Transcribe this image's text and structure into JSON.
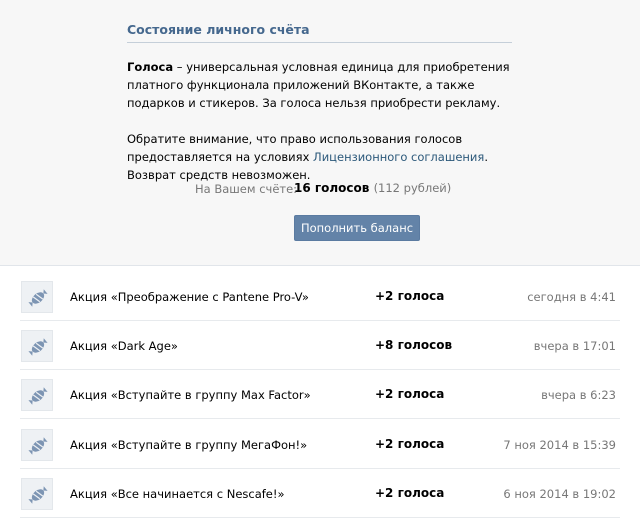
{
  "header": {
    "title": "Состояние личного счёта",
    "para1_bold": "Голоса",
    "para1_rest": " – универсальная условная единица для приобретения платного функционала приложений ВКонтакте, а также подарков и стикеров. За голоса нельзя приобрести рекламу.",
    "para2_before": "Обратите внимание, что право использования голосов предоставляется на условиях ",
    "para2_link": "Лицензионного соглашения",
    "para2_after": ". Возврат средств невозможен.",
    "balance_label": "На Вашем счёте:",
    "balance_value": "16 голосов",
    "balance_rub": "(112 рублей)",
    "topup_button": "Пополнить баланс"
  },
  "transactions": [
    {
      "name": "Акция «Преображение с Pantene Pro-V»",
      "amount": "+2 голоса",
      "time": "сегодня в 4:41",
      "icon": "candy-icon"
    },
    {
      "name": "Акция «Dark Age»",
      "amount": "+8 голосов",
      "time": "вчера в 17:01",
      "icon": "candy-icon"
    },
    {
      "name": "Акция «Вступайте в группу Max Factor»",
      "amount": "+2 голоса",
      "time": "вчера в 6:23",
      "icon": "candy-icon"
    },
    {
      "name": "Акция «Вступайте в группу МегаФон!»",
      "amount": "+2 голоса",
      "time": "7 ноя 2014 в 15:39",
      "icon": "candy-icon"
    },
    {
      "name": "Акция «Все начинается с Nescafe!»",
      "amount": "+2 голоса",
      "time": "6 ноя 2014 в 19:02",
      "icon": "candy-icon"
    }
  ],
  "colors": {
    "accent": "#45688e",
    "link": "#2b587a",
    "button": "#6383a8",
    "panel_bg": "#f7f7f7",
    "muted": "#777777"
  }
}
